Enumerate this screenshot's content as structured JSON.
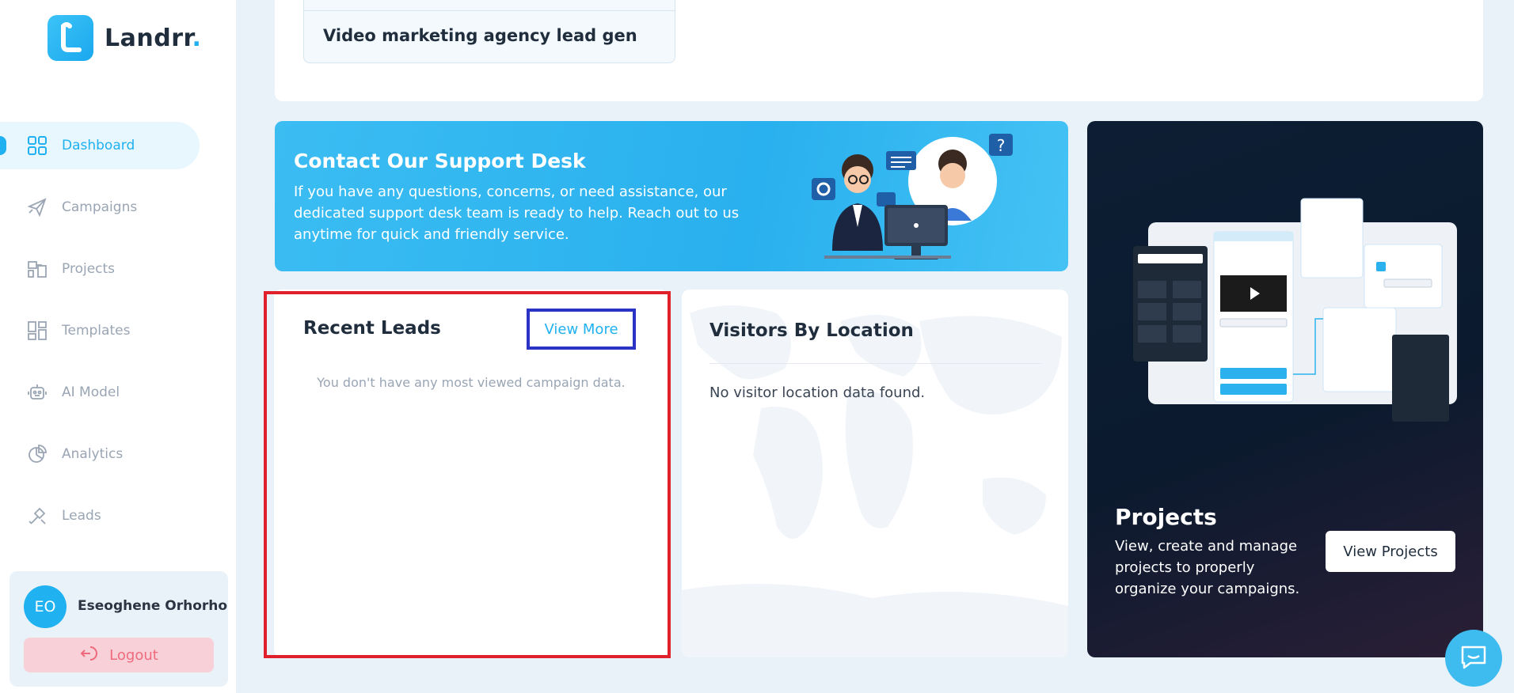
{
  "brand": {
    "name": "Landrr",
    "dot": "."
  },
  "sidebar": {
    "items": [
      {
        "label": "Dashboard",
        "icon": "grid-icon",
        "active": true
      },
      {
        "label": "Campaigns",
        "icon": "paper-plane-icon"
      },
      {
        "label": "Projects",
        "icon": "projects-icon"
      },
      {
        "label": "Templates",
        "icon": "templates-icon"
      },
      {
        "label": "AI Model",
        "icon": "robot-icon"
      },
      {
        "label": "Analytics",
        "icon": "pie-chart-icon"
      },
      {
        "label": "Leads",
        "icon": "magnet-icon"
      }
    ],
    "user": {
      "initials": "EO",
      "name": "Eseoghene Orhorho"
    },
    "logout_label": "Logout"
  },
  "top": {
    "campaign_title": "Video marketing agency lead gen"
  },
  "support": {
    "title": "Contact Our Support Desk",
    "text": "If you have any questions, concerns, or need assistance, our dedicated support desk team is ready to help. Reach out to us anytime for quick and friendly service."
  },
  "leads": {
    "title": "Recent Leads",
    "view_more": "View More",
    "empty": "You don't have any most viewed campaign data."
  },
  "visitors": {
    "title": "Visitors By Location",
    "empty": "No visitor location data found."
  },
  "projects": {
    "title": "Projects",
    "text": "View, create and manage projects to properly organize your campaigns.",
    "button": "View Projects"
  },
  "colors": {
    "accent": "#1fb1f0",
    "danger": "#f06a7e",
    "highlight_red": "#e0202a",
    "highlight_blue": "#2b33c6"
  }
}
